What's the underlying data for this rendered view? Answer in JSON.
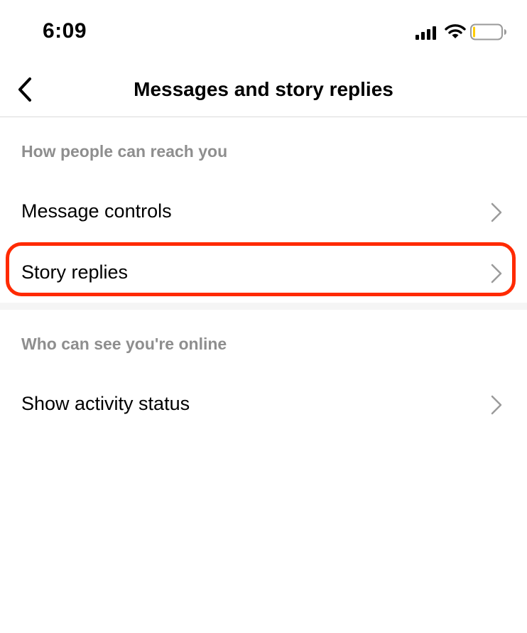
{
  "status_bar": {
    "time": "6:09",
    "icons": [
      "signal-icon",
      "wifi-icon",
      "battery-icon"
    ],
    "battery_level_fraction": 0.05,
    "battery_color": "#ffcc00"
  },
  "header": {
    "title": "Messages and story replies",
    "back_icon": "chevron-left-icon"
  },
  "sections": [
    {
      "header": "How people can reach you",
      "items": [
        {
          "label": "Message controls",
          "icon": "chevron-right-icon"
        },
        {
          "label": "Story replies",
          "icon": "chevron-right-icon",
          "highlighted": true
        }
      ]
    },
    {
      "header": "Who can see you're online",
      "items": [
        {
          "label": "Show activity status",
          "icon": "chevron-right-icon"
        }
      ]
    }
  ],
  "colors": {
    "highlight": "#ff2a00",
    "section_header": "#8e8e8e",
    "divider": "#f5f5f5"
  }
}
